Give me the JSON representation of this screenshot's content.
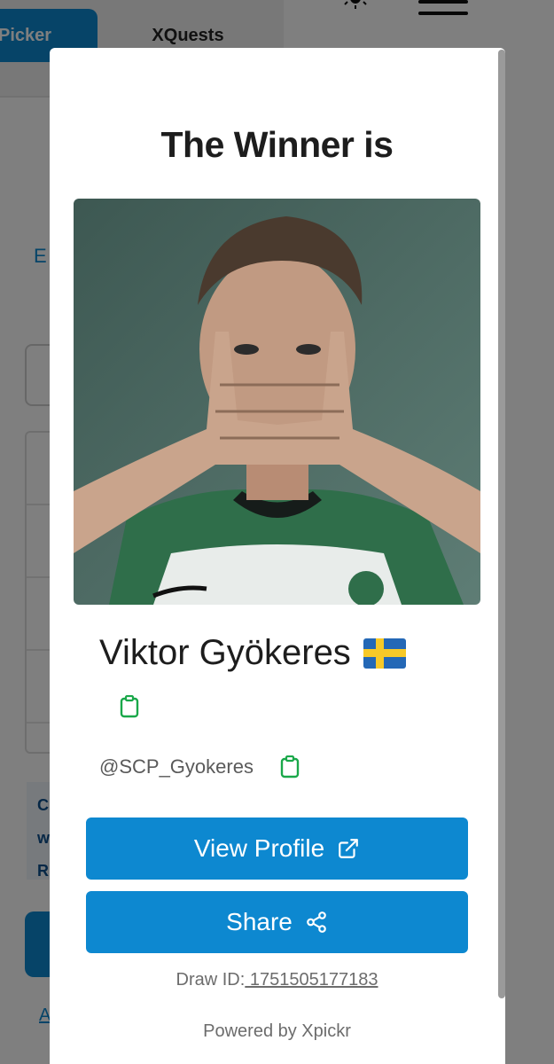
{
  "background": {
    "tabs": [
      {
        "label": "Picker",
        "active": true
      },
      {
        "label": "XQuests",
        "active": false
      }
    ],
    "partial_link": "E",
    "partial_note": [
      "C",
      "w",
      "R"
    ],
    "partial_bottom_link": "A",
    "icons": [
      "sun-icon",
      "menu-icon"
    ]
  },
  "modal": {
    "title": "The Winner is",
    "winner": {
      "name": "Viktor Gyökeres",
      "flag": "sweden-flag",
      "handle": "@SCP_Gyokeres",
      "photo_description": "profile-photo"
    },
    "buttons": {
      "view_profile": "View Profile",
      "share": "Share"
    },
    "draw": {
      "label": "Draw ID:",
      "id": " 1751505177183"
    },
    "powered_by": "Powered by Xpickr"
  },
  "colors": {
    "accent": "#0d88d0",
    "copy_icon": "#1aa84a",
    "text_dark": "#1d1d1d",
    "text_muted": "#6c6c6c"
  }
}
